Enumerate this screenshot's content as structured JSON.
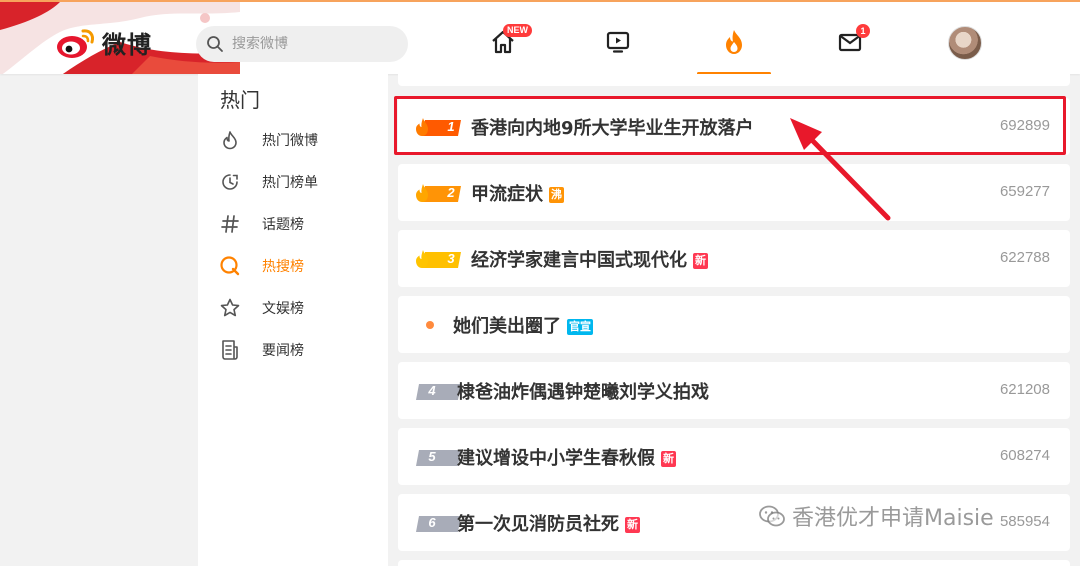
{
  "header": {
    "logo_text": "微博",
    "search_placeholder": "搜索微博",
    "nav": {
      "home_badge": "NEW",
      "messages_badge": "1"
    },
    "accent_color": "#ff8200"
  },
  "sidebar": {
    "title": "热门",
    "items": [
      {
        "label": "热门微博",
        "icon": "flame-outline-icon",
        "active": false
      },
      {
        "label": "热门榜单",
        "icon": "clock-chart-icon",
        "active": false
      },
      {
        "label": "话题榜",
        "icon": "hash-icon",
        "active": false
      },
      {
        "label": "热搜榜",
        "icon": "search-q-icon",
        "active": true
      },
      {
        "label": "文娱榜",
        "icon": "star-outline-icon",
        "active": false
      },
      {
        "label": "要闻榜",
        "icon": "news-icon",
        "active": false
      }
    ]
  },
  "hot_list": [
    {
      "rank": "1",
      "title": "香港向内地9所大学毕业生开放落户",
      "tag": "",
      "count": "692899",
      "highlighted": true
    },
    {
      "rank": "2",
      "title": "甲流症状",
      "tag": "沸",
      "tag_color": "#ff9406",
      "count": "659277"
    },
    {
      "rank": "3",
      "title": "经济学家建言中国式现代化",
      "tag": "新",
      "tag_color": "#ff3852",
      "count": "622788"
    },
    {
      "rank": "",
      "title": "她们美出圈了",
      "tag": "官宣",
      "tag_color": "#00b7ee",
      "count": ""
    },
    {
      "rank": "4",
      "title": "棣爸油炸偶遇钟楚曦刘学义拍戏",
      "tag": "",
      "count": "621208"
    },
    {
      "rank": "5",
      "title": "建议增设中小学生春秋假",
      "tag": "新",
      "tag_color": "#ff3852",
      "count": "608274"
    },
    {
      "rank": "6",
      "title": "第一次见消防员社死",
      "tag": "新",
      "tag_color": "#ff3852",
      "count": "585954"
    }
  ],
  "watermark": "香港优才申请Maisie"
}
